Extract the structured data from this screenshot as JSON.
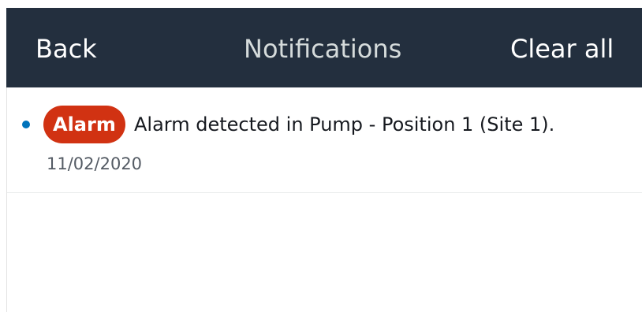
{
  "header": {
    "back_label": "Back",
    "title": "Notifications",
    "clear_label": "Clear all"
  },
  "notifications": [
    {
      "badge": "Alarm",
      "message": "Alarm detected in Pump - Position 1 (Site 1).",
      "date": "11/02/2020",
      "unread": true
    }
  ],
  "colors": {
    "header_background": "#232f3e",
    "badge_alarm": "#d13212",
    "unread_dot": "#0073bb"
  }
}
